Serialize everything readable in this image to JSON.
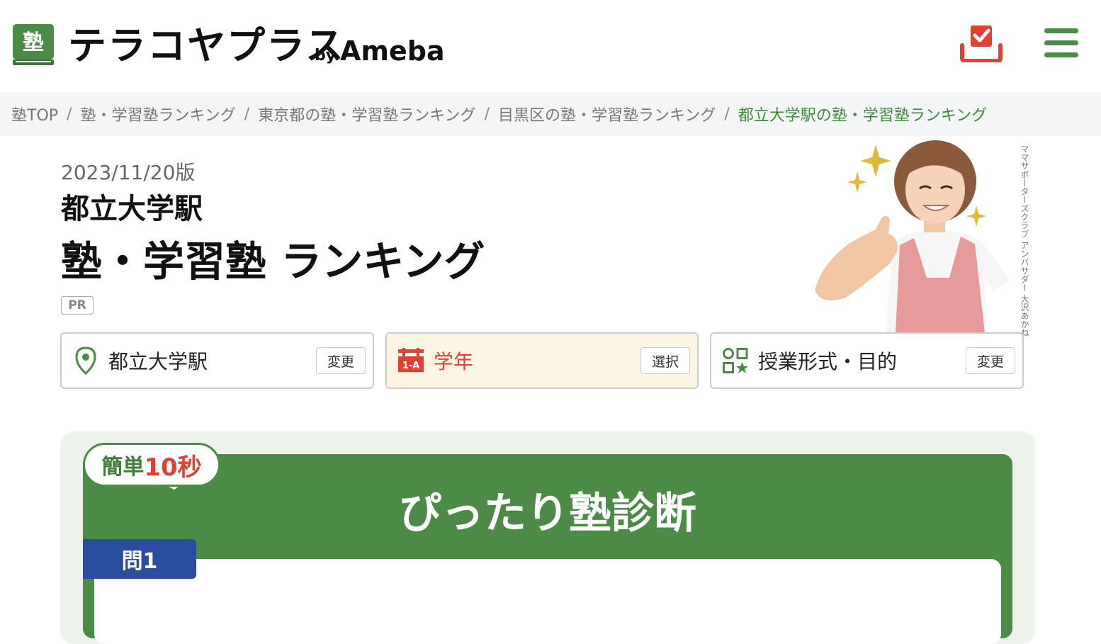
{
  "header": {
    "logo_icon_char": "塾",
    "logo_text": "テラコヤプラス",
    "logo_by": "by",
    "logo_ameba": "Ameba"
  },
  "breadcrumb": [
    {
      "label": "塾TOP"
    },
    {
      "label": "塾・学習塾ランキング"
    },
    {
      "label": "東京都の塾・学習塾ランキング"
    },
    {
      "label": "目黒区の塾・学習塾ランキング"
    },
    {
      "label": "都立大学駅の塾・学習塾ランキング"
    }
  ],
  "breadcrumb_separator": "/",
  "page": {
    "date": "2023/11/20版",
    "station": "都立大学駅",
    "title": "塾・学習塾 ランキング",
    "pr": "PR",
    "ambassador_caption": "ママサポーターズクラブ アンバサダー 大沢あかね"
  },
  "filters": {
    "location": {
      "label": "都立大学駅",
      "button": "変更",
      "icon": "map-pin-icon"
    },
    "grade": {
      "label": "学年",
      "button": "選択",
      "icon": "grade-sign-icon",
      "icon_text": "1-A"
    },
    "purpose": {
      "label": "授業形式・目的",
      "button": "変更",
      "icon": "category-icon"
    }
  },
  "diagnosis": {
    "bubble_text_1": "簡単",
    "bubble_text_2": "10秒",
    "title": "ぴったり塾診断",
    "question_label": "問1"
  },
  "colors": {
    "brand_green": "#4b8b45",
    "accent_red": "#e33f35",
    "question_blue": "#2a4da0",
    "breadcrumb_current": "#3e8a3a"
  }
}
